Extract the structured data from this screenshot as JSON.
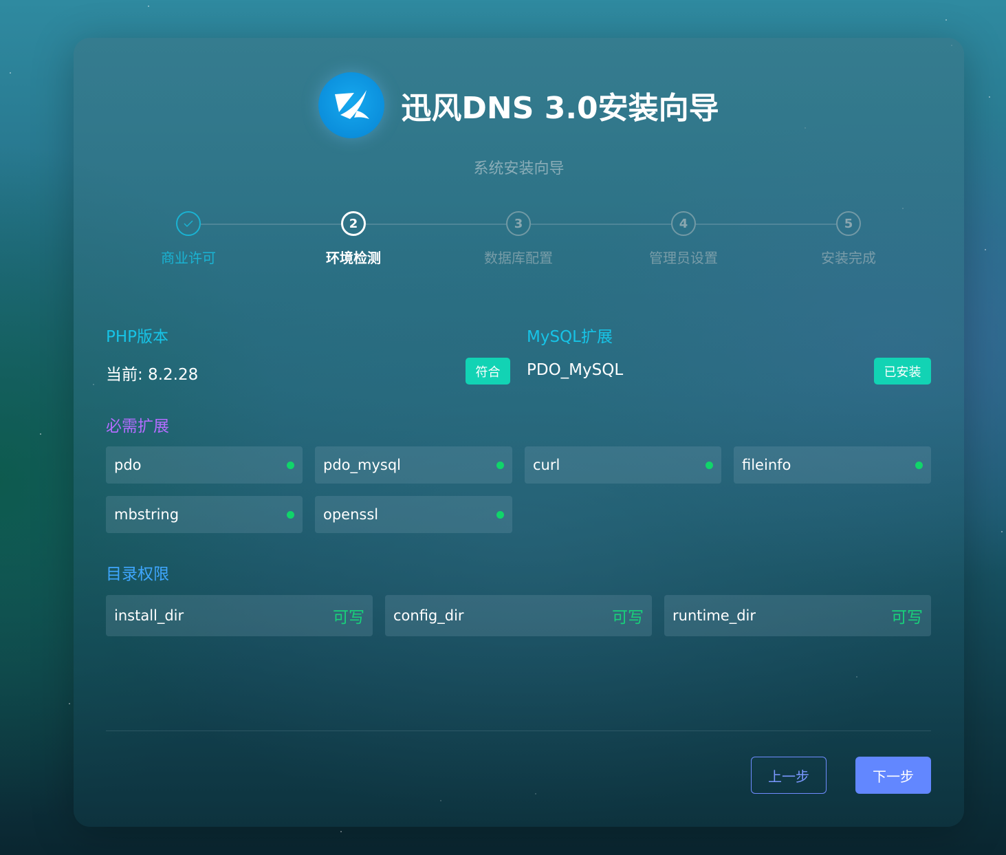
{
  "header": {
    "title": "迅风DNS 3.0安装向导",
    "subtitle": "系统安装向导"
  },
  "steps": [
    {
      "number": "",
      "label": "商业许可",
      "state": "done"
    },
    {
      "number": "2",
      "label": "环境检测",
      "state": "active"
    },
    {
      "number": "3",
      "label": "数据库配置",
      "state": "pending"
    },
    {
      "number": "4",
      "label": "管理员设置",
      "state": "pending"
    },
    {
      "number": "5",
      "label": "安装完成",
      "state": "pending"
    }
  ],
  "php": {
    "title": "PHP版本",
    "current": "当前: 8.2.28",
    "status": "符合"
  },
  "mysql": {
    "title": "MySQL扩展",
    "name": "PDO_MySQL",
    "status": "已安装"
  },
  "extensions": {
    "title": "必需扩展",
    "items": [
      "pdo",
      "pdo_mysql",
      "curl",
      "fileinfo",
      "mbstring",
      "openssl"
    ]
  },
  "directories": {
    "title": "目录权限",
    "items": [
      {
        "name": "install_dir",
        "state": "可写"
      },
      {
        "name": "config_dir",
        "state": "可写"
      },
      {
        "name": "runtime_dir",
        "state": "可写"
      }
    ]
  },
  "buttons": {
    "prev": "上一步",
    "next": "下一步"
  },
  "colors": {
    "done": "#1ab3d3",
    "section_cyan": "#17c3e6",
    "section_purple": "#b36cff",
    "section_blue": "#3fa7ff",
    "badge": "#12d3b4",
    "ok_dot": "#10d56a",
    "writable": "#18d27a",
    "primary_button": "#6287ff"
  }
}
